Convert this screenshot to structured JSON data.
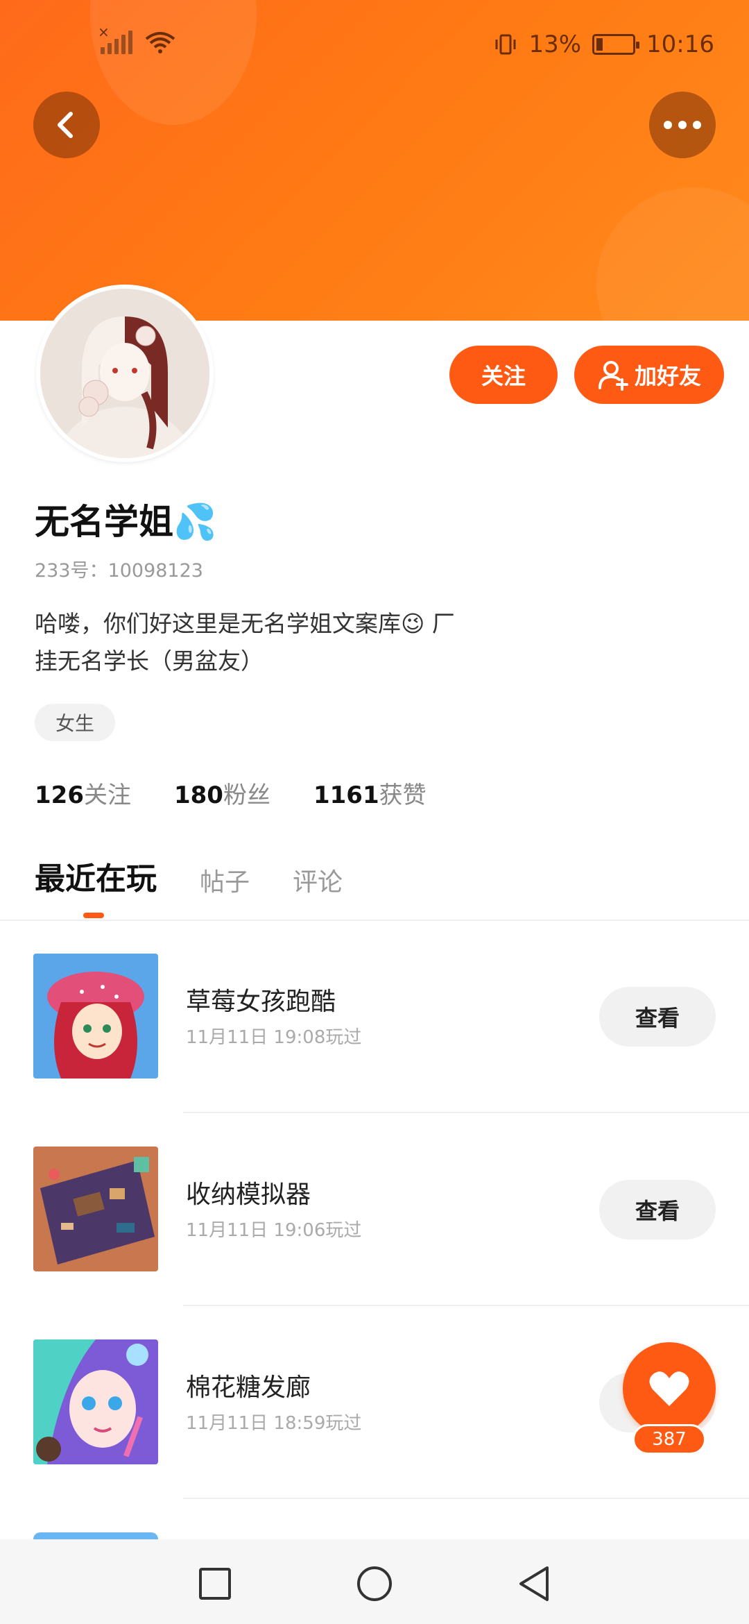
{
  "status_bar": {
    "battery": "13%",
    "time": "10:16"
  },
  "header": {
    "back_icon": "chevron-left-icon",
    "more_icon": "more-dots-icon"
  },
  "actions": {
    "follow_label": "关注",
    "add_friend_label": "加好友"
  },
  "profile": {
    "name": "无名学姐💦",
    "id_text": "233号：10098123",
    "bio_line1": "哈喽，你们好这里是无名学姐文案库😉 厂",
    "bio_line2": "挂无名学长（男盆友）",
    "tag": "女生",
    "stats": [
      {
        "num": "126",
        "label": "关注"
      },
      {
        "num": "180",
        "label": "粉丝"
      },
      {
        "num": "1161",
        "label": "获赞"
      }
    ]
  },
  "tabs": [
    {
      "label": "最近在玩",
      "active": true
    },
    {
      "label": "帖子",
      "active": false
    },
    {
      "label": "评论",
      "active": false
    }
  ],
  "games": [
    {
      "title": "草莓女孩跑酷",
      "time": "11月11日 19:08玩过",
      "button": "查看"
    },
    {
      "title": "收纳模拟器",
      "time": "11月11日 19:06玩过",
      "button": "查看"
    },
    {
      "title": "棉花糖发廊",
      "time": "11月11日 18:59玩过",
      "button": "查看"
    }
  ],
  "like": {
    "count": "387"
  },
  "colors": {
    "accent": "#ff5a14",
    "banner": "#ff7a14"
  }
}
